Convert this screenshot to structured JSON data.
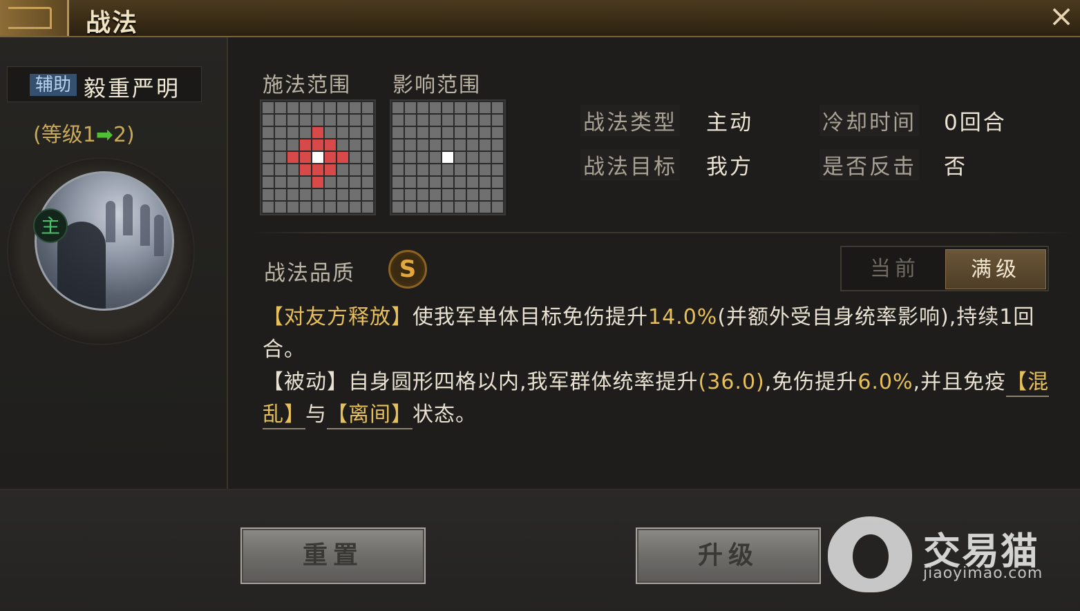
{
  "window": {
    "title": "战法",
    "close_icon": "×"
  },
  "skill": {
    "tag": "辅助",
    "name": "毅重严明",
    "level_prefix": "(等级1",
    "level_arrow": "➡",
    "level_suffix": "2)",
    "commander_badge": "主"
  },
  "ranges": {
    "cast_label": "施法范围",
    "effect_label": "影响范围"
  },
  "info": {
    "type_key": "战法类型",
    "type_val": "主动",
    "cooldown_key": "冷却时间",
    "cooldown_val": "0回合",
    "target_key": "战法目标",
    "target_val": "我方",
    "counter_key": "是否反击",
    "counter_val": "否"
  },
  "quality": {
    "label": "战法品质",
    "grade": "S"
  },
  "toggle": {
    "current": "当前",
    "max": "满级"
  },
  "description": {
    "p1_tag": "【对友方释放】",
    "p1_a": "使我军单体目标免伤提升",
    "p1_num": "14.0%",
    "p1_b": "(并额外受自身统率影响),持续1回合。",
    "p2_a": "【被动】自身圆形四格以内,我军群体统率提升",
    "p2_num1": "(36.0)",
    "p2_b": ",免伤提升",
    "p2_num2": "6.0%",
    "p2_c": ",并且免疫",
    "p2_link1": "【混乱】",
    "p2_d": "与",
    "p2_link2": "【离间】",
    "p2_e": "状态。"
  },
  "buttons": {
    "reset": "重置",
    "upgrade": "升级"
  },
  "watermark": {
    "cn": "交易猫",
    "en": "jiaoyimao.com"
  },
  "colors": {
    "gold": "#e7c05a",
    "accent_green": "#4fbf34",
    "range_red": "#d84a4a"
  }
}
